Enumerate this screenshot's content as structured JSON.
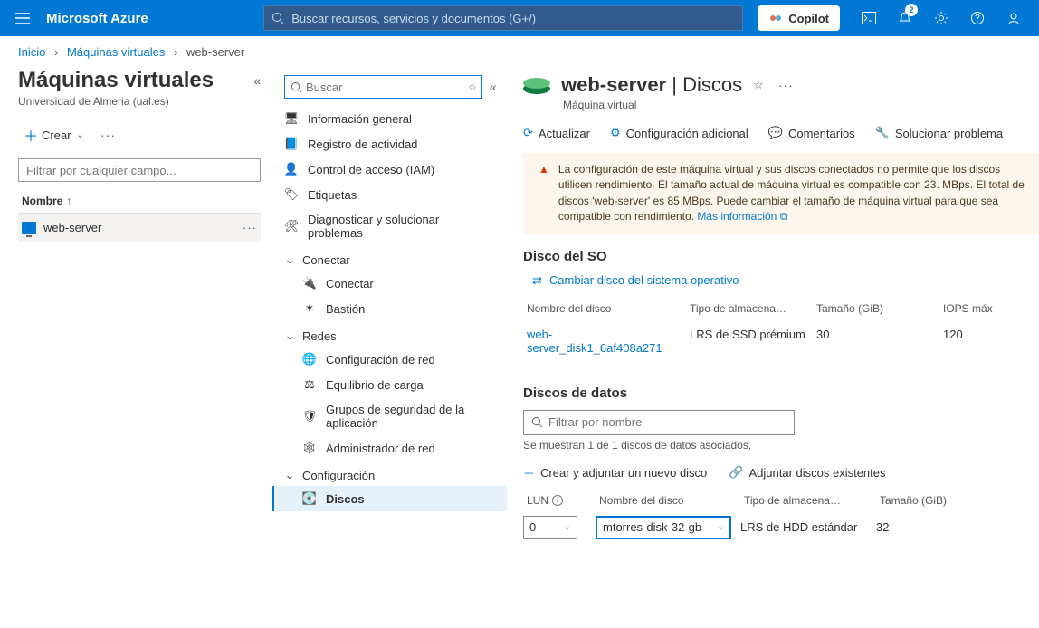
{
  "topbar": {
    "brand": "Microsoft Azure",
    "search_placeholder": "Buscar recursos, servicios y documentos (G+/)",
    "copilot": "Copilot",
    "notification_count": "2"
  },
  "breadcrumb": {
    "home": "Inicio",
    "vms": "Máquinas virtuales",
    "current": "web-server"
  },
  "left": {
    "title": "Máquinas virtuales",
    "subtitle": "Universidad de Almeria (ual.es)",
    "create": "Crear",
    "filter_placeholder": "Filtrar por cualquier campo...",
    "col_name": "Nombre",
    "row_name": "web-server"
  },
  "menu": {
    "search_placeholder": "Buscar",
    "overview": "Información general",
    "activity": "Registro de actividad",
    "iam": "Control de acceso (IAM)",
    "tags": "Etiquetas",
    "diagnose": "Diagnosticar y solucionar problemas",
    "g_connect": "Conectar",
    "connect": "Conectar",
    "bastion": "Bastión",
    "g_networking": "Redes",
    "netconf": "Configuración de red",
    "lb": "Equilibrio de carga",
    "asg": "Grupos de seguridad de la aplicación",
    "netadmin": "Administrador de red",
    "g_settings": "Configuración",
    "disks": "Discos"
  },
  "right": {
    "title_name": "web-server",
    "title_sep": " | ",
    "title_section": "Discos",
    "subtitle": "Máquina virtual",
    "tb_refresh": "Actualizar",
    "tb_additional": "Configuración adicional",
    "tb_feedback": "Comentarios",
    "tb_troubleshoot": "Solucionar problema",
    "warn_text": "La configuración de este máquina virtual y sus discos conectados no permite que los discos utilicen rendimiento. El tamaño actual de máquina virtual es compatible con 23. MBps. El total de discos 'web-server' es 85 MBps. Puede cambiar el tamaño de máquina virtual para que sea compatible con rendimiento. ",
    "warn_link": "Más información",
    "osdisk_title": "Disco del SO",
    "swap_link": "Cambiar disco del sistema operativo",
    "os_h_name": "Nombre del disco",
    "os_h_type": "Tipo de almacena…",
    "os_h_size": "Tamaño (GiB)",
    "os_h_iops": "IOPS máx",
    "os_name": "web-server_disk1_6af408a271",
    "os_type": "LRS de SSD prémium",
    "os_size": "30",
    "os_iops": "120",
    "datadisk_title": "Discos de datos",
    "filter2_placeholder": "Filtrar por nombre",
    "shown": "Se muestran 1 de 1 discos de datos asociados.",
    "create_attach": "Crear y adjuntar un nuevo disco",
    "attach_existing": "Adjuntar discos existentes",
    "dd_h_lun": "LUN",
    "dd_h_name": "Nombre del disco",
    "dd_h_type": "Tipo de almacena…",
    "dd_h_size": "Tamaño (GiB)",
    "dd_lun": "0",
    "dd_name": "mtorres-disk-32-gb",
    "dd_type": "LRS de HDD estándar",
    "dd_size": "32"
  }
}
